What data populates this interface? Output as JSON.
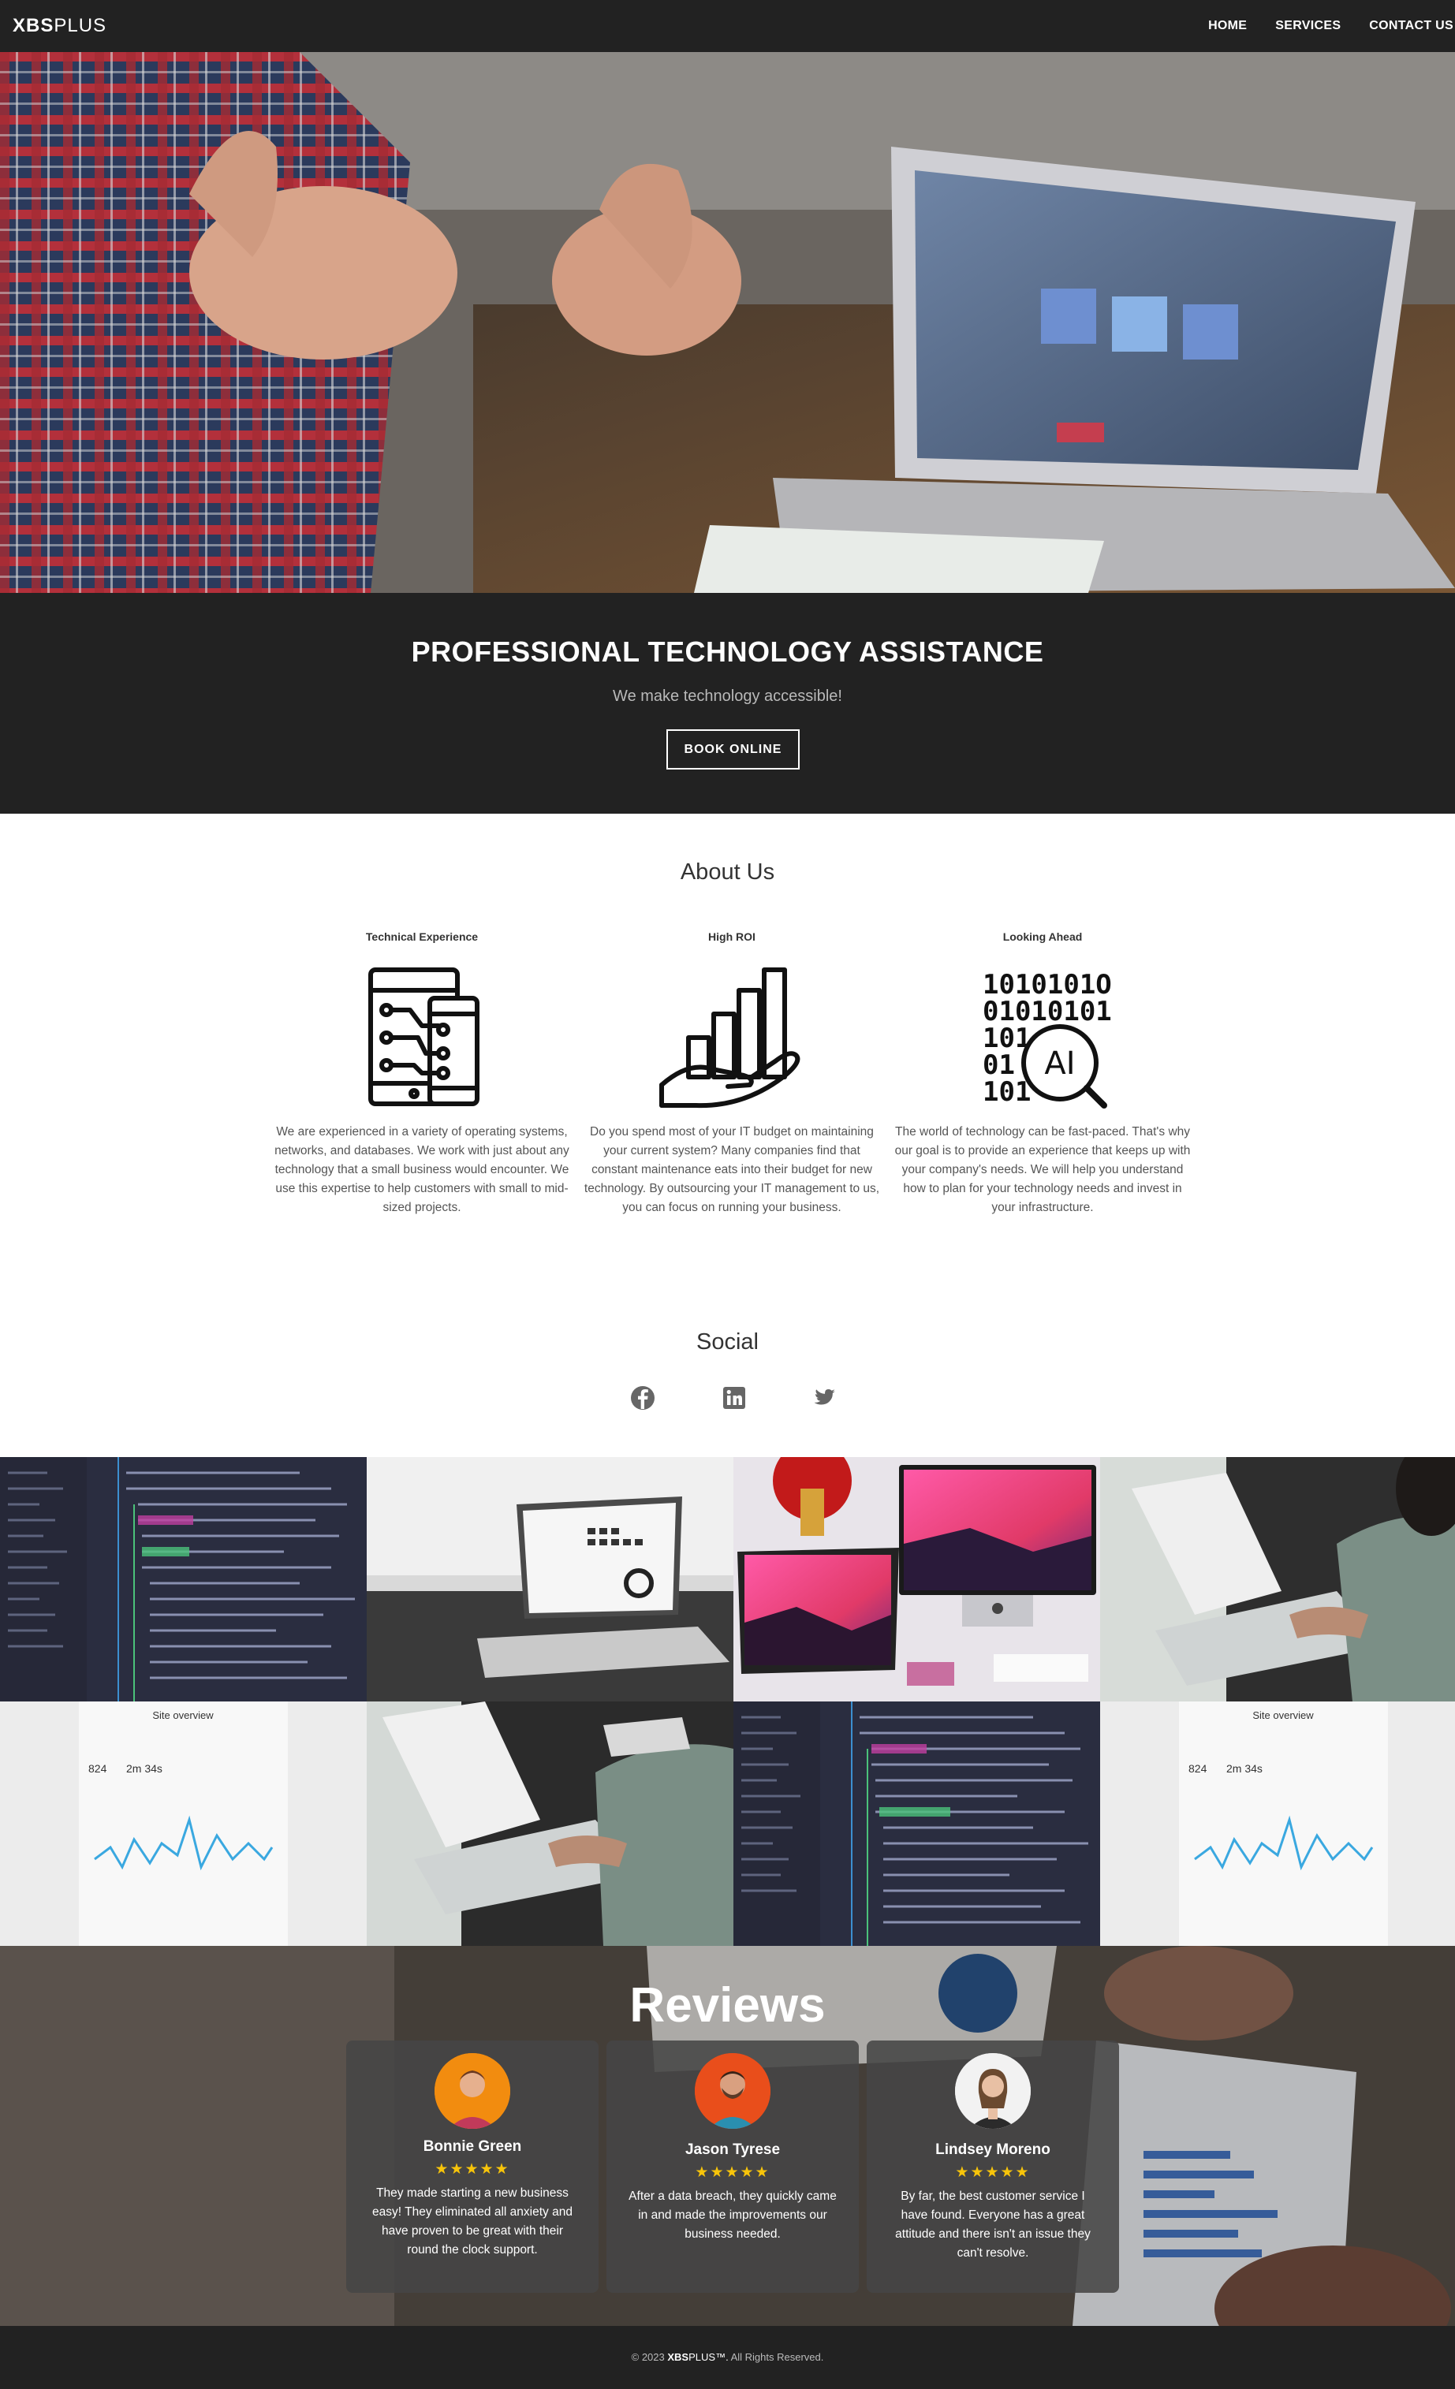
{
  "nav": {
    "logo_bold": "XBS",
    "logo_light": "PLUS",
    "links": [
      "HOME",
      "SERVICES",
      "CONTACT US"
    ]
  },
  "hero": {
    "title": "PROFESSIONAL TECHNOLOGY ASSISTANCE",
    "subtitle": "We make technology accessible!",
    "button": "BOOK ONLINE"
  },
  "about": {
    "title": "About Us",
    "columns": [
      {
        "heading": "Technical Experience",
        "icon": "circuit-device-icon",
        "text": "We are experienced in a variety of operating systems, networks, and databases. We work with just about any technology that a small business would encounter. We use this expertise to help customers with small to mid-sized projects."
      },
      {
        "heading": "High ROI",
        "icon": "hand-growth-chart-icon",
        "text": "Do you spend most of your IT budget on maintaining your current system? Many companies find that constant maintenance eats into their budget for new technology. By outsourcing your IT management to us, you can focus on running your business."
      },
      {
        "heading": "Looking Ahead",
        "icon": "binary-ai-icon",
        "text": "The world of technology can be fast-paced. That's why our goal is to provide an experience that keeps up with your company's needs. We will help you understand how to plan for your technology needs and invest in your infrastructure."
      }
    ],
    "binary_lines": [
      "1010101O",
      "01010101",
      "101",
      "01",
      "101"
    ],
    "ai_label": "AI"
  },
  "social": {
    "title": "Social",
    "icons": [
      "facebook-icon",
      "linkedin-icon",
      "twitter-icon"
    ]
  },
  "gallery": {
    "site_overview_title": "Site overview",
    "stat_a": "824",
    "stat_b": "2m 34s"
  },
  "reviews": {
    "title": "Reviews",
    "items": [
      {
        "name": "Bonnie Green",
        "stars": "★★★★★",
        "text": "They made starting a new business easy! They eliminated all anxiety and have proven to be great with their round the clock support."
      },
      {
        "name": "Jason Tyrese",
        "stars": "★★★★★",
        "text": "After a data breach, they quickly came in and made the improvements our business needed."
      },
      {
        "name": "Lindsey Moreno",
        "stars": "★★★★★",
        "text": "By far, the best customer service I have found. Everyone has a great attitude and there isn't an issue they can't resolve."
      }
    ]
  },
  "footer": {
    "prefix": "© 2023",
    "brand_bold": "XBS",
    "brand_light": "PLUS™.",
    "suffix": "All Rights Reserved."
  },
  "colors": {
    "nav_bg": "#222222",
    "star": "#f7c40a",
    "card_bg": "#464646"
  }
}
